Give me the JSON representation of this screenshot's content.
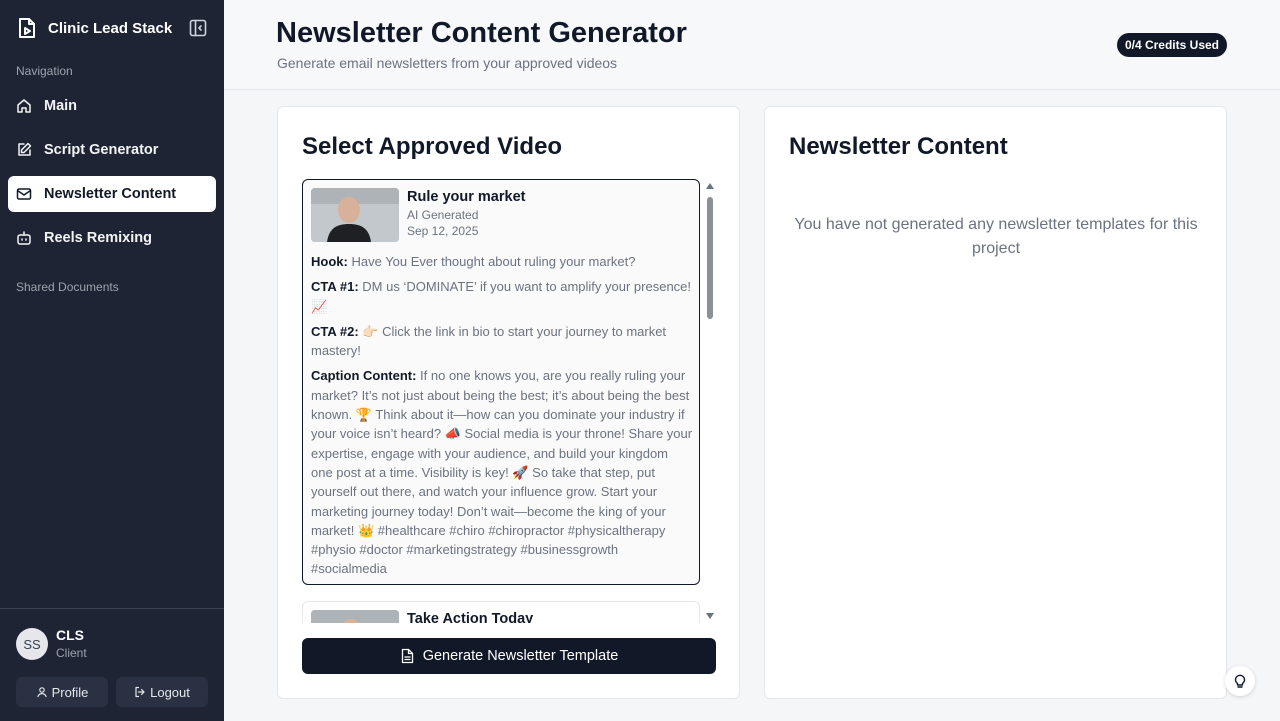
{
  "brand": {
    "name": "Clinic Lead Stack",
    "icon": "file-play-icon",
    "collapse_icon": "sidebar-collapse-icon"
  },
  "sidebar": {
    "nav_heading": "Navigation",
    "items": [
      {
        "label": "Main",
        "icon": "home-icon",
        "active": false
      },
      {
        "label": "Script Generator",
        "icon": "edit-icon",
        "active": false
      },
      {
        "label": "Newsletter Content",
        "icon": "mail-icon",
        "active": true
      },
      {
        "label": "Reels Remixing",
        "icon": "bot-icon",
        "active": false
      }
    ],
    "shared_heading": "Shared Documents"
  },
  "user": {
    "initials": "SS",
    "name": "CLS",
    "role": "Client",
    "profile_label": "Profile",
    "logout_label": "Logout"
  },
  "header": {
    "title": "Newsletter Content Generator",
    "subtitle": "Generate email newsletters from your approved videos",
    "credits_badge": "0/4 Credits Used"
  },
  "select_panel": {
    "title": "Select Approved Video",
    "videos": [
      {
        "title": "Rule your market",
        "source": "AI Generated",
        "date": "Sep 12, 2025",
        "hook_label": "Hook:",
        "hook": "Have You Ever thought about ruling your market?",
        "cta1_label": "CTA #1:",
        "cta1": "DM us ‘DOMINATE’ if you want to amplify your presence! 📈",
        "cta2_label": "CTA #2:",
        "cta2": "👉🏻 Click the link in bio to start your journey to market mastery!",
        "caption_label": "Caption Content:",
        "caption": "If no one knows you, are you really ruling your market? It’s not just about being the best; it’s about being the best known. 🏆 Think about it—how can you dominate your industry if your voice isn’t heard? 📣 Social media is your throne! Share your expertise, engage with your audience, and build your kingdom one post at a time. Visibility is key! 🚀 So take that step, put yourself out there, and watch your influence grow. Start your marketing journey today! Don’t wait—become the king of your market! 👑 #healthcare #chiro #chiropractor #physicaltherapy #physio #doctor #marketingstrategy #businessgrowth #socialmedia"
      },
      {
        "title": "Take Action Today"
      }
    ],
    "generate_button": "Generate Newsletter Template"
  },
  "content_panel": {
    "title": "Newsletter Content",
    "empty_message": "You have not generated any newsletter templates for this project"
  },
  "colors": {
    "sidebar_bg": "#1e2433",
    "primary": "#111827",
    "muted": "#6b7280"
  }
}
